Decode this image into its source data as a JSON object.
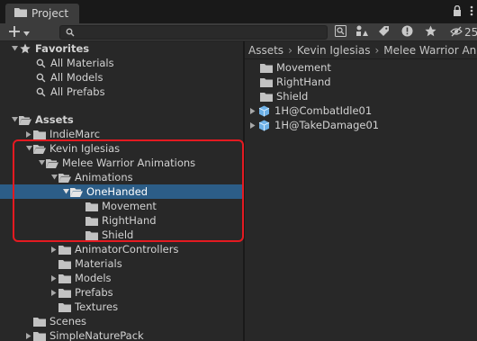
{
  "window": {
    "tab_title": "Project",
    "hidden_count": "25"
  },
  "toolbar": {
    "search_placeholder": ""
  },
  "tree": {
    "favorites": {
      "label": "Favorites",
      "items": [
        {
          "label": "All Materials"
        },
        {
          "label": "All Models"
        },
        {
          "label": "All Prefabs"
        }
      ]
    },
    "assets": {
      "label": "Assets",
      "items": [
        {
          "label": "IndieMarc"
        },
        {
          "label": "Kevin Iglesias"
        },
        {
          "label": "Melee Warrior Animations"
        },
        {
          "label": "Animations"
        },
        {
          "label": "OneHanded"
        },
        {
          "label": "Movement"
        },
        {
          "label": "RightHand"
        },
        {
          "label": "Shield"
        },
        {
          "label": "AnimatorControllers"
        },
        {
          "label": "Materials"
        },
        {
          "label": "Models"
        },
        {
          "label": "Prefabs"
        },
        {
          "label": "Textures"
        },
        {
          "label": "Scenes"
        },
        {
          "label": "SimpleNaturePack"
        }
      ]
    }
  },
  "content": {
    "breadcrumb": [
      "Assets",
      "Kevin Iglesias",
      "Melee Warrior An"
    ],
    "items": [
      {
        "label": "Movement"
      },
      {
        "label": "RightHand"
      },
      {
        "label": "Shield"
      },
      {
        "label": "1H@CombatIdle01"
      },
      {
        "label": "1H@TakeDamage01"
      }
    ]
  },
  "colors": {
    "selection": "#2c5d87",
    "highlight_box": "#e41a21",
    "folder": "#c2c2c2",
    "model_icon": "#6db0e6"
  }
}
